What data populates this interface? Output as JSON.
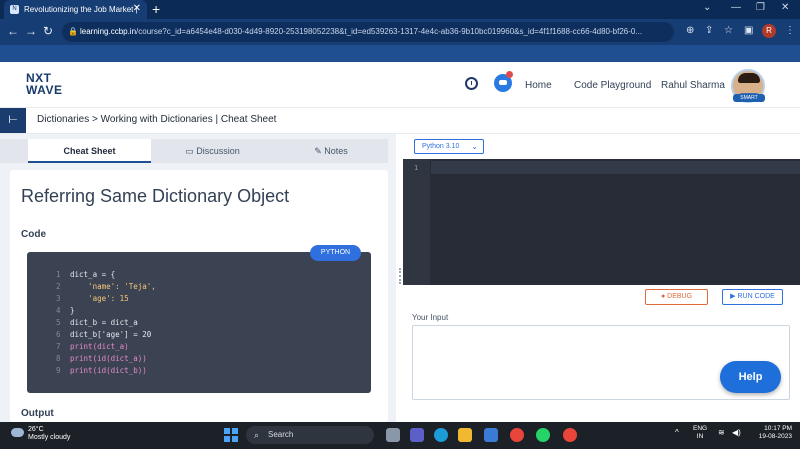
{
  "browser": {
    "tab_title": "Revolutionizing the Job Market |",
    "tab_close": "✕",
    "new_tab": "+",
    "url_domain": "learning.ccbp.in",
    "url_path": "/course?c_id=a6454e48-d030-4d49-8920-253198052238&t_id=ed539263-1317-4e4c-ab36-9b10bc019960&s_id=4f1f1688-cc66-4d80-bf26-0...",
    "profile_initial": "R"
  },
  "header": {
    "logo_line1": "NXT",
    "logo_line2": "WAVE",
    "nav_home": "Home",
    "nav_code_playground": "Code Playground",
    "user_name": "Rahul Sharma",
    "avatar_badge": "SMART"
  },
  "breadcrumb": "Dictionaries > Working with Dictionaries | Cheat Sheet",
  "left_tabs": {
    "cheat_sheet": "Cheat Sheet",
    "discussion": "Discussion",
    "notes": "Notes"
  },
  "content": {
    "title": "Referring Same Dictionary Object",
    "code_label": "Code",
    "language_badge": "PYTHON",
    "output_label": "Output",
    "code_lines": [
      {
        "num": "1",
        "text": "dict_a = {"
      },
      {
        "num": "2",
        "text": "    'name': 'Teja',"
      },
      {
        "num": "3",
        "text": "    'age': 15"
      },
      {
        "num": "4",
        "text": "}"
      },
      {
        "num": "5",
        "text": "dict_b = dict_a"
      },
      {
        "num": "6",
        "text": "dict_b['age'] = 20"
      },
      {
        "num": "7",
        "text": "print(dict_a)"
      },
      {
        "num": "8",
        "text": "print(id(dict_a))"
      },
      {
        "num": "9",
        "text": "print(id(dict_b))"
      }
    ]
  },
  "editor": {
    "version": "Python 3.10",
    "line_number": "1",
    "debug_label": "DEBUG",
    "run_label": "RUN CODE",
    "input_label": "Your Input",
    "help_label": "Help"
  },
  "taskbar": {
    "temperature": "26°C",
    "weather": "Mostly cloudy",
    "search_placeholder": "Search",
    "lang_line1": "ENG",
    "lang_line2": "IN",
    "time": "10:17 PM",
    "date": "19-08-2023"
  },
  "colors": {
    "brand_dark": "#1a3c6e",
    "accent_blue": "#2f6fde",
    "debug_orange": "#e06a3a",
    "editor_bg": "#272c36"
  }
}
